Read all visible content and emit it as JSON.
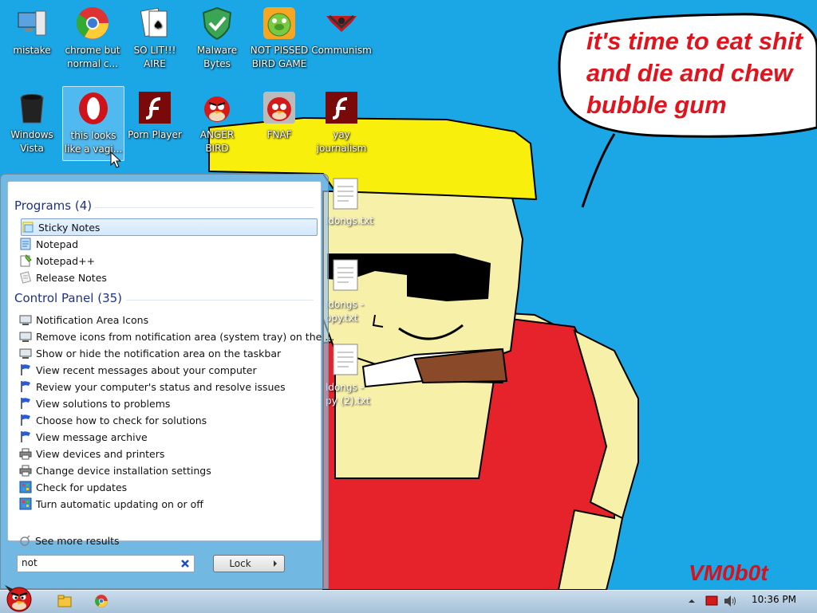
{
  "desktop": {
    "icons": [
      {
        "label": "mistake",
        "icon": "computer-pc-icon"
      },
      {
        "label": "chrome but\nnormal c...",
        "icon": "chrome-icon"
      },
      {
        "label": "SO LIT!!!\nAIRE",
        "icon": "solitaire-cards-icon"
      },
      {
        "label": "Malware\nBytes",
        "icon": "shield-check-icon"
      },
      {
        "label": "NOT PISSED\nBIRD GAME",
        "icon": "green-pig-icon"
      },
      {
        "label": "Communism",
        "icon": "emblem-icon"
      },
      {
        "label": "Windows\nVista",
        "icon": "recycle-bin-icon"
      },
      {
        "label": "this looks\nlike a vagi...",
        "icon": "opera-icon"
      },
      {
        "label": "Porn Player",
        "icon": "flash-icon"
      },
      {
        "label": "ANGER\nBIRD",
        "icon": "angry-bird-icon"
      },
      {
        "label": "FNAF",
        "icon": "angry-bird-icon"
      },
      {
        "label": "yay\njournalism",
        "icon": "flash-icon"
      }
    ],
    "text_files": [
      {
        "label": "ldongs.txt"
      },
      {
        "label": "ldongs -\nopy.txt"
      },
      {
        "label": "ldongs -\npy (2).txt"
      }
    ],
    "speech_text": "it's time to eat shit\nand die and chew\nbubble gum",
    "watermark": "VM0b0t"
  },
  "start_menu": {
    "programs_header": "Programs (4)",
    "programs": [
      {
        "label": "Sticky Notes",
        "icon": "sticky-notes-icon",
        "selected": true
      },
      {
        "label": "Notepad",
        "icon": "notepad-icon"
      },
      {
        "label": "Notepad++",
        "icon": "notepadpp-icon"
      },
      {
        "label": "Release Notes",
        "icon": "release-notes-icon"
      }
    ],
    "control_header": "Control Panel (35)",
    "control_items": [
      {
        "label": "Notification Area Icons",
        "icon": "monitor-icon"
      },
      {
        "label": "Remove icons from notification area (system tray) on the ...",
        "icon": "monitor-icon"
      },
      {
        "label": "Show or hide the notification area on the taskbar",
        "icon": "monitor-icon"
      },
      {
        "label": "View recent messages about your computer",
        "icon": "flag-icon"
      },
      {
        "label": "Review your computer's status and resolve issues",
        "icon": "flag-icon"
      },
      {
        "label": "View solutions to problems",
        "icon": "flag-icon"
      },
      {
        "label": "Choose how to check for solutions",
        "icon": "flag-icon"
      },
      {
        "label": "View message archive",
        "icon": "flag-icon"
      },
      {
        "label": "View devices and printers",
        "icon": "printer-icon"
      },
      {
        "label": "Change device installation settings",
        "icon": "printer-icon"
      },
      {
        "label": "Check for updates",
        "icon": "windows-update-icon"
      },
      {
        "label": "Turn automatic updating on or off",
        "icon": "windows-update-icon"
      }
    ],
    "see_more": "See more results",
    "search_value": "not",
    "lock_label": "Lock"
  },
  "taskbar": {
    "time": "10:36 PM"
  },
  "colors": {
    "background": "#1ba6e6",
    "accent_red": "#d8121b"
  }
}
